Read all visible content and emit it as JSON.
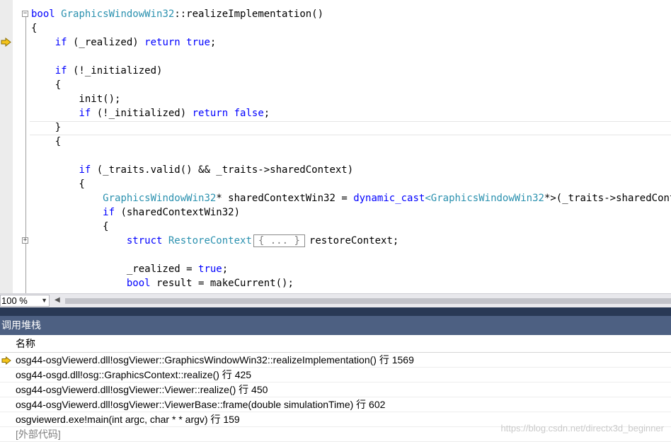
{
  "editor": {
    "lines": [
      [
        {
          "t": "bool",
          "c": "kw"
        },
        {
          "t": " "
        },
        {
          "t": "GraphicsWindowWin32",
          "c": "ty"
        },
        {
          "t": "::realizeImplementation()"
        }
      ],
      [
        {
          "t": "{"
        }
      ],
      [
        {
          "t": "    "
        },
        {
          "t": "if",
          "c": "kw"
        },
        {
          "t": " (_realized) "
        },
        {
          "t": "return",
          "c": "kw"
        },
        {
          "t": " "
        },
        {
          "t": "true",
          "c": "kw"
        },
        {
          "t": ";"
        }
      ],
      [],
      [
        {
          "t": "    "
        },
        {
          "t": "if",
          "c": "kw"
        },
        {
          "t": " (!_initialized)"
        }
      ],
      [
        {
          "t": "    {"
        }
      ],
      [
        {
          "t": "        init();"
        }
      ],
      [
        {
          "t": "        "
        },
        {
          "t": "if",
          "c": "kw"
        },
        {
          "t": " (!_initialized) "
        },
        {
          "t": "return",
          "c": "kw"
        },
        {
          "t": " "
        },
        {
          "t": "false",
          "c": "kw"
        },
        {
          "t": ";"
        }
      ],
      [
        {
          "t": "    }"
        }
      ],
      [
        {
          "t": "    {"
        }
      ],
      [],
      [
        {
          "t": "        "
        },
        {
          "t": "if",
          "c": "kw"
        },
        {
          "t": " (_traits.valid() && _traits->sharedContext)"
        }
      ],
      [
        {
          "t": "        {"
        }
      ],
      [
        {
          "t": "            "
        },
        {
          "t": "GraphicsWindowWin32",
          "c": "ty"
        },
        {
          "t": "* sharedContextWin32 = "
        },
        {
          "t": "dynamic_cast",
          "c": "kw"
        },
        {
          "t": "<",
          "c": "ty"
        },
        {
          "t": "GraphicsWindowWin32",
          "c": "ty"
        },
        {
          "t": "*>(_traits->sharedContext);"
        }
      ],
      [
        {
          "t": "            "
        },
        {
          "t": "if",
          "c": "kw"
        },
        {
          "t": " (sharedContextWin32)"
        }
      ],
      [
        {
          "t": "            {"
        }
      ],
      [
        {
          "t": "                "
        },
        {
          "t": "struct",
          "c": "kw"
        },
        {
          "t": " "
        },
        {
          "t": "RestoreContext",
          "c": "ty"
        },
        {
          "t": "{ ... }",
          "c": "box"
        },
        {
          "t": "restoreContext;"
        }
      ],
      [],
      [
        {
          "t": "                _realized = "
        },
        {
          "t": "true",
          "c": "kw"
        },
        {
          "t": ";"
        }
      ],
      [
        {
          "t": "                "
        },
        {
          "t": "bool",
          "c": "kw"
        },
        {
          "t": " result = makeCurrent();"
        }
      ]
    ]
  },
  "statusbar": {
    "zoom": "100 %"
  },
  "call_stack": {
    "title": "调用堆栈",
    "column_name": "名称",
    "rows": [
      {
        "text": "osg44-osgViewerd.dll!osgViewer::GraphicsWindowWin32::realizeImplementation() 行 1569",
        "current": true
      },
      {
        "text": "osg44-osgd.dll!osg::GraphicsContext::realize() 行 425"
      },
      {
        "text": "osg44-osgViewerd.dll!osgViewer::Viewer::realize() 行 450"
      },
      {
        "text": "osg44-osgViewerd.dll!osgViewer::ViewerBase::frame(double simulationTime) 行 602"
      },
      {
        "text": "osgviewerd.exe!main(int argc, char * * argv) 行 159"
      },
      {
        "text": "[外部代码]",
        "external": true
      }
    ]
  },
  "watermark": "https://blog.csdn.net/directx3d_beginner",
  "colors": {
    "keyword": "#0000ff",
    "type": "#2b91af",
    "panel_title": "#4d6082",
    "arrow": "#f5c41a"
  }
}
